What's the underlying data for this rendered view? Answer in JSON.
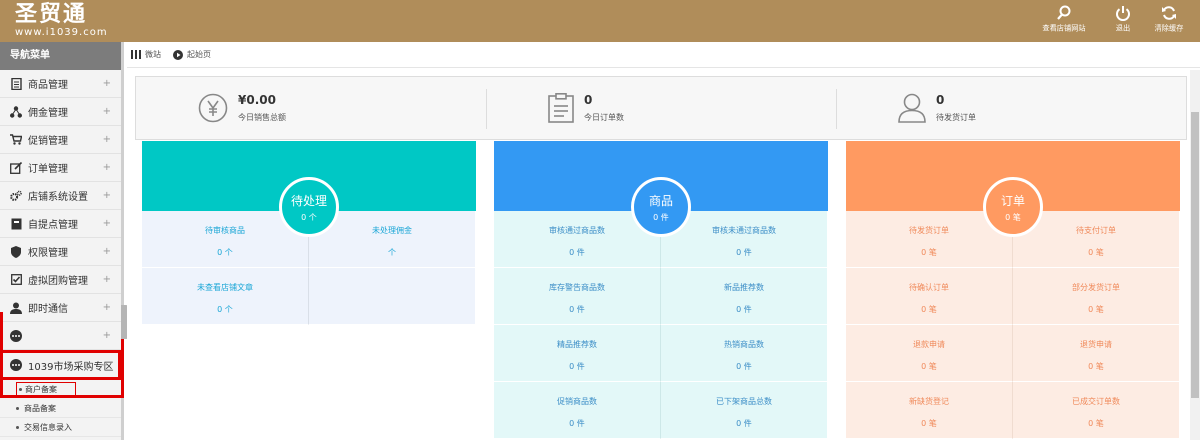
{
  "logo": {
    "main": "圣贸通",
    "sub": "www.i1039.com"
  },
  "header_tools": [
    {
      "label": "查看店铺网站",
      "icon": "search-icon"
    },
    {
      "label": "退出",
      "icon": "power-icon"
    },
    {
      "label": "清除缓存",
      "icon": "refresh-icon"
    }
  ],
  "sidebar": {
    "title": "导航菜单",
    "items": [
      {
        "label": "商品管理",
        "icon": "document-icon",
        "expander": "+"
      },
      {
        "label": "佣金管理",
        "icon": "share-icon",
        "expander": "+"
      },
      {
        "label": "促销管理",
        "icon": "cart-icon",
        "expander": "+"
      },
      {
        "label": "订单管理",
        "icon": "edit-icon",
        "expander": "+"
      },
      {
        "label": "店铺系统设置",
        "icon": "gears-icon",
        "expander": "+"
      },
      {
        "label": "自提点管理",
        "icon": "book-icon",
        "expander": "+"
      },
      {
        "label": "权限管理",
        "icon": "shield-icon",
        "expander": "+"
      },
      {
        "label": "虚拟团购管理",
        "icon": "checkbox-icon",
        "expander": "+"
      },
      {
        "label": "即时通信",
        "icon": "user-icon",
        "expander": "+"
      },
      {
        "label": "",
        "icon": "more-icon",
        "expander": "+"
      }
    ],
    "active_item": {
      "label": "1039市场采购专区",
      "icon": "more-icon",
      "expander": "−"
    },
    "sub_items": [
      "商户备案",
      "商品备案",
      "交易信息录入"
    ]
  },
  "breadcrumb": {
    "items": [
      "微站",
      "起始页"
    ]
  },
  "stats": [
    {
      "value": "¥0.00",
      "label": "今日销售总额",
      "icon": "yen-icon"
    },
    {
      "value": "0",
      "label": "今日订单数",
      "icon": "clipboard-icon"
    },
    {
      "value": "0",
      "label": "待发货订单",
      "icon": "person-icon"
    }
  ],
  "cards": [
    {
      "title": "待处理",
      "subtitle": "0 个",
      "color": "#00c8c5",
      "cells": [
        {
          "label": "待审核商品",
          "value": "0 个"
        },
        {
          "label": "未处理佣金",
          "value": "个"
        },
        {
          "label": "未查看店铺文章",
          "value": "0 个"
        },
        {
          "label": "",
          "value": ""
        }
      ]
    },
    {
      "title": "商品",
      "subtitle": "0 件",
      "color": "#3399f3",
      "cells": [
        {
          "label": "审核通过商品数",
          "value": "0 件"
        },
        {
          "label": "审核未通过商品数",
          "value": "0 件"
        },
        {
          "label": "库存警告商品数",
          "value": "0 件"
        },
        {
          "label": "新品推荐数",
          "value": "0 件"
        },
        {
          "label": "精品推荐数",
          "value": "0 件"
        },
        {
          "label": "热销商品数",
          "value": "0 件"
        },
        {
          "label": "促销商品数",
          "value": "0 件"
        },
        {
          "label": "已下架商品总数",
          "value": "0 件"
        }
      ]
    },
    {
      "title": "订单",
      "subtitle": "0 笔",
      "color": "#ff9a61",
      "cells": [
        {
          "label": "待发货订单",
          "value": "0 笔"
        },
        {
          "label": "待支付订单",
          "value": "0 笔"
        },
        {
          "label": "待确认订单",
          "value": "0 笔"
        },
        {
          "label": "部分发货订单",
          "value": "0 笔"
        },
        {
          "label": "退款申请",
          "value": "0 笔"
        },
        {
          "label": "退货申请",
          "value": "0 笔"
        },
        {
          "label": "新缺货登记",
          "value": "0 笔"
        },
        {
          "label": "已成交订单数",
          "value": "0 笔"
        }
      ]
    }
  ]
}
